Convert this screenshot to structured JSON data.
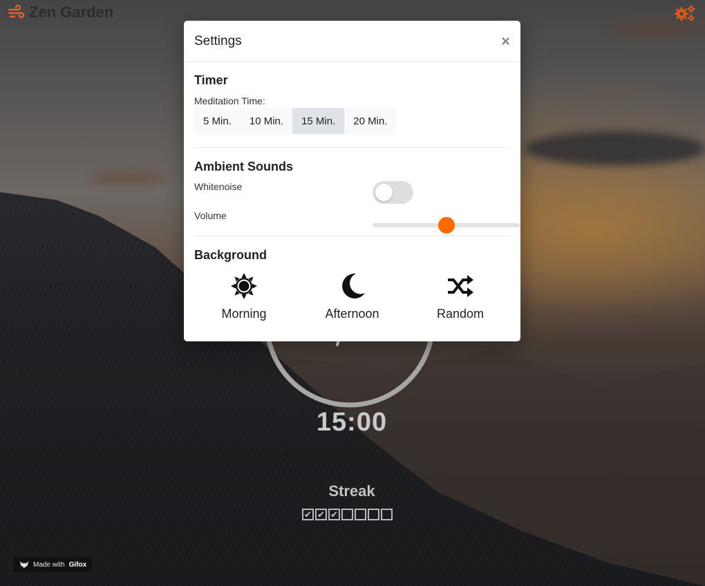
{
  "app": {
    "title": "Zen Garden"
  },
  "header": {
    "brand_icon": "wind-icon",
    "settings_icon": "gears-icon",
    "accent_color": "#e8602a"
  },
  "timer": {
    "display": "15:00"
  },
  "streak": {
    "label": "Streak",
    "days": [
      true,
      true,
      true,
      false,
      false,
      false,
      false
    ]
  },
  "watermark": {
    "prefix": "Made with",
    "name": "Gifox"
  },
  "settings_modal": {
    "title": "Settings",
    "close_label": "×",
    "timer_section": {
      "title": "Timer",
      "meditation_label": "Meditation Time:",
      "options": [
        "5 Min.",
        "10 Min.",
        "15 Min.",
        "20 Min."
      ],
      "selected": "15 Min."
    },
    "sounds_section": {
      "title": "Ambient Sounds",
      "whitenoise_label": "Whitenoise",
      "whitenoise_on": false,
      "volume_label": "Volume",
      "volume_fraction": 0.5
    },
    "background_section": {
      "title": "Background",
      "options": [
        {
          "label": "Morning",
          "icon": "sun-icon"
        },
        {
          "label": "Afternoon",
          "icon": "moon-icon"
        },
        {
          "label": "Random",
          "icon": "shuffle-icon"
        }
      ]
    },
    "slider_color": "#ff6a00"
  }
}
